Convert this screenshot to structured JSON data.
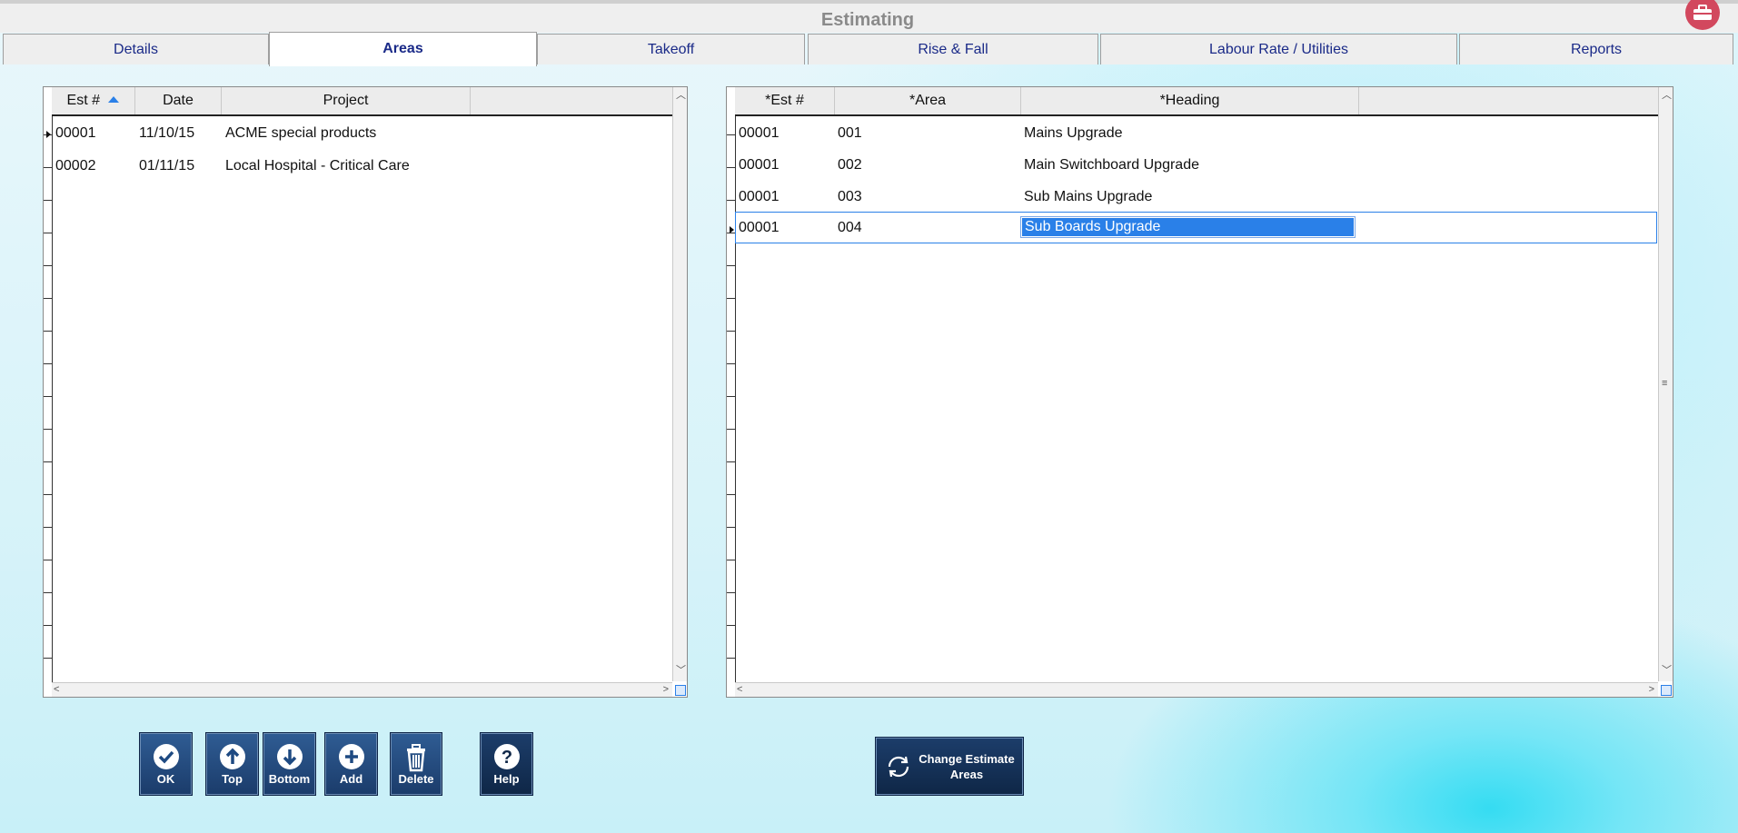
{
  "app": {
    "title": "Estimating"
  },
  "tabs": [
    {
      "label": "Details",
      "active": false
    },
    {
      "label": "Areas",
      "active": true
    },
    {
      "label": "Takeoff",
      "active": false
    },
    {
      "label": "Rise & Fall",
      "active": false
    },
    {
      "label": "Labour Rate / Utilities",
      "active": false
    },
    {
      "label": "Reports",
      "active": false
    }
  ],
  "left_grid": {
    "columns": [
      "Est #",
      "Date",
      "Project"
    ],
    "rows": [
      {
        "est": "00001",
        "date": "11/10/15",
        "project": "ACME special products"
      },
      {
        "est": "00002",
        "date": "01/11/15",
        "project": "Local Hospital - Critical Care"
      }
    ]
  },
  "right_grid": {
    "columns": [
      "*Est #",
      "*Area",
      "*Heading"
    ],
    "rows": [
      {
        "est": "00001",
        "area": "001",
        "heading": "Mains Upgrade"
      },
      {
        "est": "00001",
        "area": "002",
        "heading": "Main Switchboard Upgrade"
      },
      {
        "est": "00001",
        "area": "003",
        "heading": "Sub Mains Upgrade"
      },
      {
        "est": "00001",
        "area": "004",
        "heading": "Sub Boards Upgrade"
      }
    ]
  },
  "buttons": {
    "ok": "OK",
    "top": "Top",
    "bottom": "Bottom",
    "add": "Add",
    "delete": "Delete",
    "help": "Help",
    "change_line1": "Change Estimate",
    "change_line2": "Areas"
  },
  "colors": {
    "accent": "#2a80e8",
    "tab_text": "#1a2a88",
    "button": "#1b3c6b",
    "badge": "#d2485e"
  }
}
